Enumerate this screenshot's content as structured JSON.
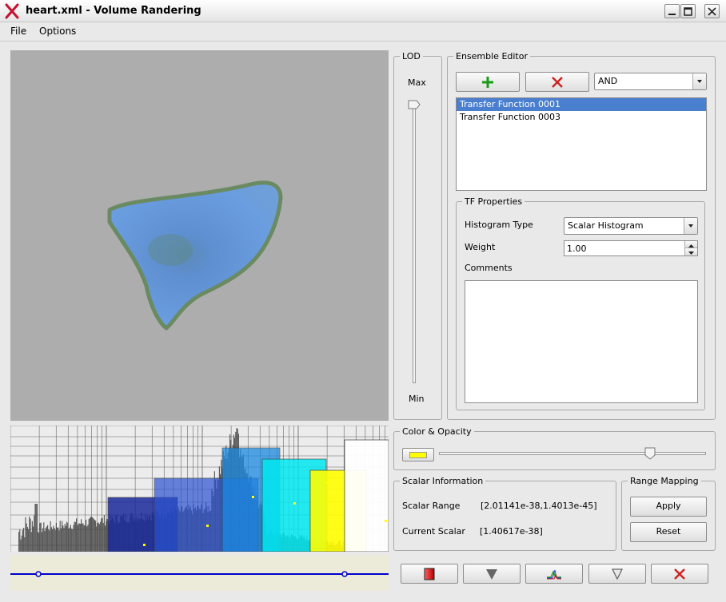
{
  "window": {
    "title": "heart.xml - Volume Randering"
  },
  "menu": {
    "file": "File",
    "options": "Options"
  },
  "lod": {
    "legend": "LOD",
    "max_label": "Max",
    "min_label": "Min",
    "value": 1.0
  },
  "ensemble": {
    "legend": "Ensemble Editor",
    "operator": "AND",
    "items": [
      {
        "label": "Transfer Function 0001",
        "selected": true
      },
      {
        "label": "Transfer Function 0003",
        "selected": false
      }
    ]
  },
  "tf_properties": {
    "legend": "TF Properties",
    "histogram_type_label": "Histogram Type",
    "histogram_type_value": "Scalar Histogram",
    "weight_label": "Weight",
    "weight_value": "1.00",
    "comments_label": "Comments",
    "comments_value": ""
  },
  "color_opacity": {
    "legend": "Color & Opacity",
    "swatch_color": "#ffff00",
    "opacity": 0.79
  },
  "scalar_info": {
    "legend": "Scalar Information",
    "range_label": "Scalar Range",
    "range_value": "[2.01141e-38,1.4013e-45]",
    "current_label": "Current Scalar",
    "current_value": "[1.40617e-38]"
  },
  "range_mapping": {
    "legend": "Range Mapping",
    "apply_label": "Apply",
    "reset_label": "Reset"
  },
  "colors": {
    "accent": "#4a7fd0",
    "add_green": "#1a9a1a",
    "remove_red": "#d02020",
    "tf_line": "#0000cc"
  }
}
